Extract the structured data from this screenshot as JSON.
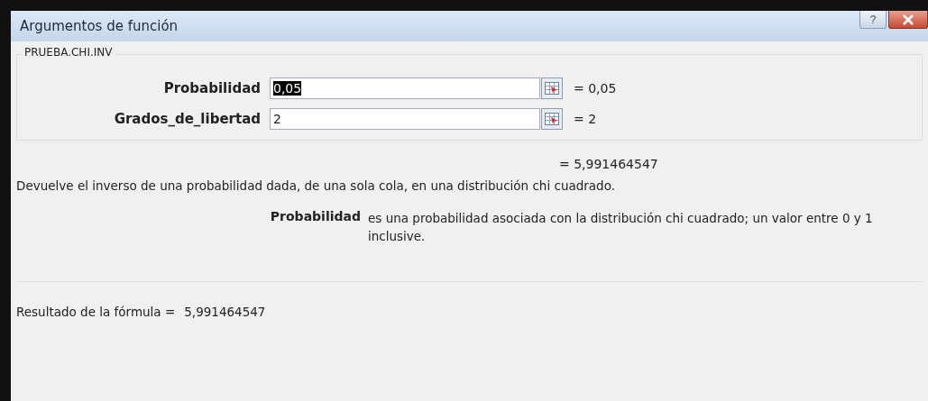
{
  "window": {
    "title": "Argumentos de función",
    "help_button": "?"
  },
  "function_name": "PRUEBA.CHI.INV",
  "arguments": [
    {
      "label": "Probabilidad",
      "value": "0,05",
      "selected": true,
      "result": "= 0,05"
    },
    {
      "label": "Grados_de_libertad",
      "value": "2",
      "selected": false,
      "result": "= 2"
    }
  ],
  "result": "= 5,991464547",
  "description": "Devuelve el inverso de una probabilidad dada, de una sola cola, en una distribución chi cuadrado.",
  "argument_help": {
    "name": "Probabilidad",
    "text": "es una probabilidad asociada con la distribución chi cuadrado; un valor entre 0 y 1 inclusive."
  },
  "formula_result": {
    "label": "Resultado de la fórmula =",
    "value": "5,991464547"
  }
}
